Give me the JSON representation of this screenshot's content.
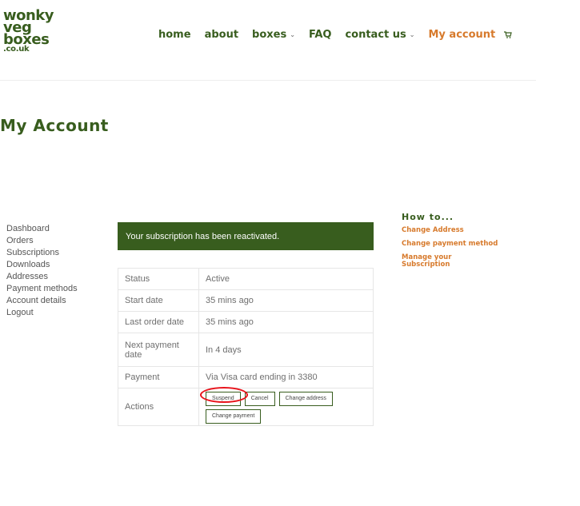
{
  "logo": {
    "line1": "wonky",
    "line2": "veg",
    "line3": "boxes",
    "line4": ".co.uk"
  },
  "nav": {
    "home": "home",
    "about": "about",
    "boxes": "boxes",
    "faq": "FAQ",
    "contact": "contact us",
    "my_account": "My account",
    "dropdown_glyph": "⌄",
    "cart_glyph": "🛒"
  },
  "page_title": "My Account",
  "sidebar": {
    "items": [
      {
        "label": "Dashboard"
      },
      {
        "label": "Orders"
      },
      {
        "label": "Subscriptions"
      },
      {
        "label": "Downloads"
      },
      {
        "label": "Addresses"
      },
      {
        "label": "Payment methods"
      },
      {
        "label": "Account details"
      },
      {
        "label": "Logout"
      }
    ]
  },
  "notice": "Your subscription has been reactivated.",
  "subscription": {
    "rows": [
      {
        "key": "Status",
        "value": "Active"
      },
      {
        "key": "Start date",
        "value": "35 mins ago"
      },
      {
        "key": "Last order date",
        "value": "35 mins ago"
      },
      {
        "key": "Next payment date",
        "value": "In 4 days"
      },
      {
        "key": "Payment",
        "value": "Via Visa card ending in 3380"
      },
      {
        "key": "Actions"
      }
    ],
    "actions": {
      "suspend": "Suspend",
      "cancel": "Cancel",
      "change_address": "Change address",
      "change_payment": "Change payment"
    }
  },
  "howto": {
    "title": "How to...",
    "links": [
      {
        "label": "Change Address"
      },
      {
        "label": "Change payment method"
      },
      {
        "label": "Manage your Subscription"
      }
    ]
  },
  "colors": {
    "brand_green": "#385d1e",
    "accent_orange": "#d77a2c",
    "highlight_red": "#e8141c"
  }
}
